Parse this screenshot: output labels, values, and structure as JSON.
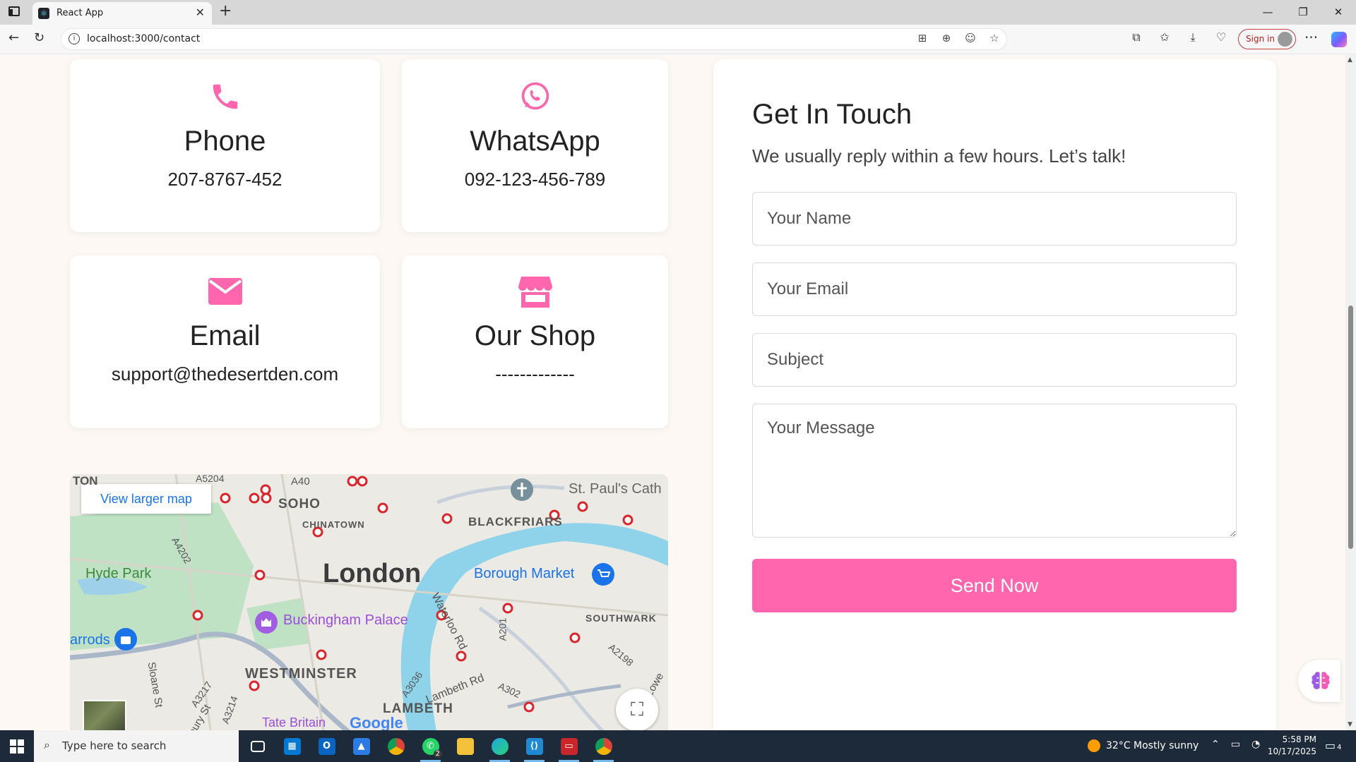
{
  "browser": {
    "tab_title": "React App",
    "url": "localhost:3000/contact",
    "signin_label": "Sign in"
  },
  "contact_cards": [
    {
      "title": "Phone",
      "value": "207-8767-452",
      "icon": "phone-icon"
    },
    {
      "title": "WhatsApp",
      "value": "092-123-456-789",
      "icon": "whatsapp-icon"
    },
    {
      "title": "Email",
      "value": "support@thedesertden.com",
      "icon": "envelope-icon"
    },
    {
      "title": "Our Shop",
      "value": "-------------",
      "icon": "store-icon"
    }
  ],
  "form": {
    "title": "Get In Touch",
    "subtitle": "We usually reply within a few hours. Let’s talk!",
    "name_placeholder": "Your Name",
    "email_placeholder": "Your Email",
    "subject_placeholder": "Subject",
    "message_placeholder": "Your Message",
    "submit_label": "Send Now"
  },
  "map": {
    "larger_map_link": "View larger map",
    "labels": {
      "city": "London",
      "soho": "SOHO",
      "chinatown": "CHINATOWN",
      "blackfriars": "BLACKFRIARS",
      "hyde_park": "Hyde Park",
      "borough_market": "Borough Market",
      "buckingham": "Buckingham Palace",
      "westminster": "WESTMINSTER",
      "southwark": "SOUTHWARK",
      "lambeth": "LAMBETH",
      "st_pauls": "St. Paul's Cath",
      "harrods": "arrods",
      "tate": "Tate Britain",
      "ton": "TON",
      "a40": "A40",
      "a5204": "A5204",
      "a4202": "A4202",
      "waterloo": "Waterloo Rd",
      "a201": "A201",
      "a2198": "A2198",
      "a3036": "A3036",
      "lambeth_rd": "Lambeth Rd",
      "a302": "A302",
      "a3217": "A3217",
      "sloane": "Sloane St",
      "a3214": "A3214",
      "bury_st": "bury St",
      "google": "Google",
      "lowe": "Lowe"
    }
  },
  "taskbar": {
    "search_placeholder": "Type here to search",
    "weather": "32°C  Mostly sunny",
    "time": "5:58 PM",
    "date": "10/17/2025",
    "whatsapp_badge": "2",
    "notif_count": "4"
  },
  "colors": {
    "accent": "#ff66ad",
    "page_bg": "#fdf8f3"
  }
}
